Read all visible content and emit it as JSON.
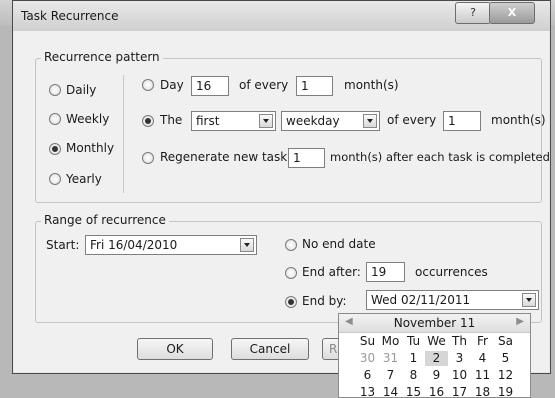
{
  "dialog": {
    "title": "Task Recurrence",
    "help_glyph": "?",
    "close_glyph": "X"
  },
  "pattern": {
    "legend": "Recurrence pattern",
    "types": [
      "Daily",
      "Weekly",
      "Monthly",
      "Yearly"
    ],
    "selected_type": "Monthly",
    "day_option": {
      "label_day": "Day",
      "day_value": "16",
      "label_of_every": "of every",
      "month_interval": "1",
      "label_months": "month(s)"
    },
    "the_option": {
      "label_the": "The",
      "ordinal": "first",
      "day_kind": "weekday",
      "label_of_every": "of every",
      "month_interval": "1",
      "label_months": "month(s)",
      "selected": true
    },
    "regenerate_option": {
      "label": "Regenerate new task",
      "value": "1",
      "suffix": "month(s) after each task is completed"
    }
  },
  "range": {
    "legend": "Range of recurrence",
    "start_label": "Start:",
    "start_value": "Fri 16/04/2010",
    "no_end_label": "No end date",
    "end_after_label": "End after:",
    "end_after_value": "19",
    "occurrences_label": "occurrences",
    "end_by_label": "End by:",
    "end_by_value": "Wed 02/11/2011",
    "selected": "End by"
  },
  "buttons": {
    "ok": "OK",
    "cancel": "Cancel",
    "remove_partial": "R"
  },
  "calendar": {
    "title": "November 11",
    "prev_glyph": "◀",
    "next_glyph": "▶",
    "weekdays": [
      "Su",
      "Mo",
      "Tu",
      "We",
      "Th",
      "Fr",
      "Sa"
    ],
    "rows": [
      [
        "30",
        "31",
        "1",
        "2",
        "3",
        "4",
        "5"
      ],
      [
        "6",
        "7",
        "8",
        "9",
        "10",
        "11",
        "12"
      ],
      [
        "13",
        "14",
        "15",
        "16",
        "17",
        "18",
        "19"
      ]
    ],
    "selected_day": "2"
  }
}
